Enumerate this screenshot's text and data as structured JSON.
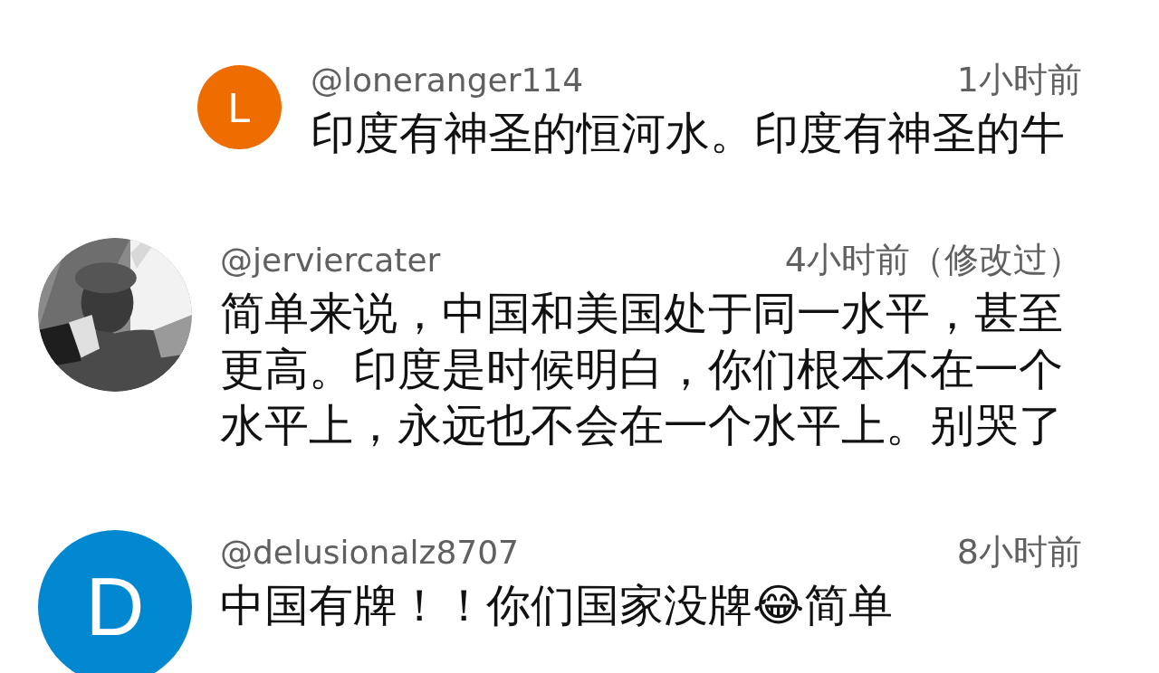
{
  "comments": [
    {
      "reply": true,
      "avatar": {
        "kind": "letter",
        "letter": "L",
        "color": "#ef6c00"
      },
      "user": "@loneranger114",
      "time": "1小时前",
      "text": "印度有神圣的恒河水。印度有神圣的牛"
    },
    {
      "reply": false,
      "user": "@jerviercater",
      "time": "4小时前（修改过）",
      "text": "简单来说，中国和美国处于同一水平，甚至更高。印度是时候明白，你们根本不在一个水平上，永远也不会在一个水平上。别哭了"
    },
    {
      "reply": false,
      "avatar": {
        "kind": "letter",
        "letter": "D",
        "color": "#0288d1"
      },
      "user": "@delusionalz8707",
      "time": "8小时前",
      "text": "中国有牌！！你们国家没牌😂简单"
    }
  ]
}
